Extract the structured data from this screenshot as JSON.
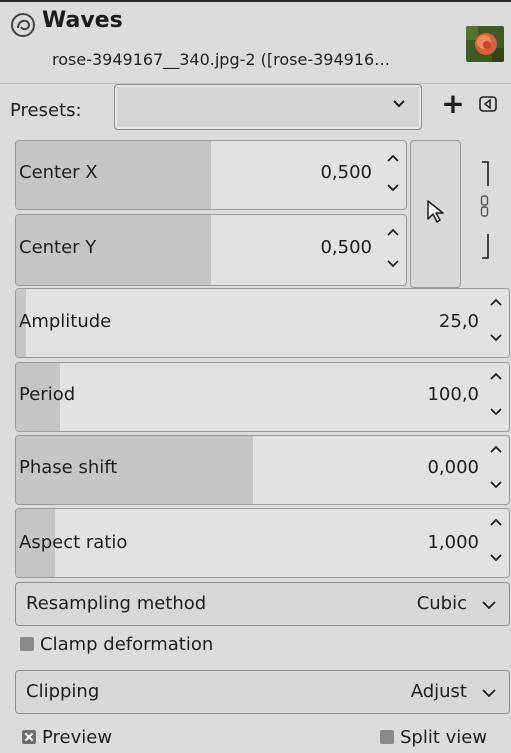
{
  "header": {
    "title": "Waves",
    "subtitle": "rose-3949167__340.jpg-2 ([rose-394916…"
  },
  "presets": {
    "label": "Presets:",
    "value": "",
    "add_symbol": "+"
  },
  "center_x": {
    "label": "Center X",
    "value": "0,500",
    "fraction": 0.5
  },
  "center_y": {
    "label": "Center Y",
    "value": "0,500",
    "fraction": 0.5
  },
  "amplitude": {
    "label": "Amplitude",
    "value": "25,0",
    "fraction": 0.02
  },
  "period": {
    "label": "Period",
    "value": "100,0",
    "fraction": 0.09
  },
  "phase_shift": {
    "label": "Phase shift",
    "value": "0,000",
    "fraction": 0.5
  },
  "aspect_ratio": {
    "label": "Aspect ratio",
    "value": "1,000",
    "fraction": 0.08
  },
  "resampling": {
    "label": "Resampling method",
    "value": "Cubic"
  },
  "clamp": {
    "label": "Clamp deformation",
    "checked": false
  },
  "clipping": {
    "label": "Clipping",
    "value": "Adjust"
  },
  "preview": {
    "label": "Preview",
    "checked": true
  },
  "split_view": {
    "label": "Split view",
    "checked": false
  },
  "colors": {
    "accent_fill": "#c6c6c6",
    "background": "#dcdcdc"
  },
  "icons": [
    "gimp-icon",
    "chevron-down-icon",
    "plus-icon",
    "menu-arrow-icon",
    "spin-up-icon",
    "spin-down-icon",
    "pick-pointer-icon",
    "chain-link-icon"
  ]
}
